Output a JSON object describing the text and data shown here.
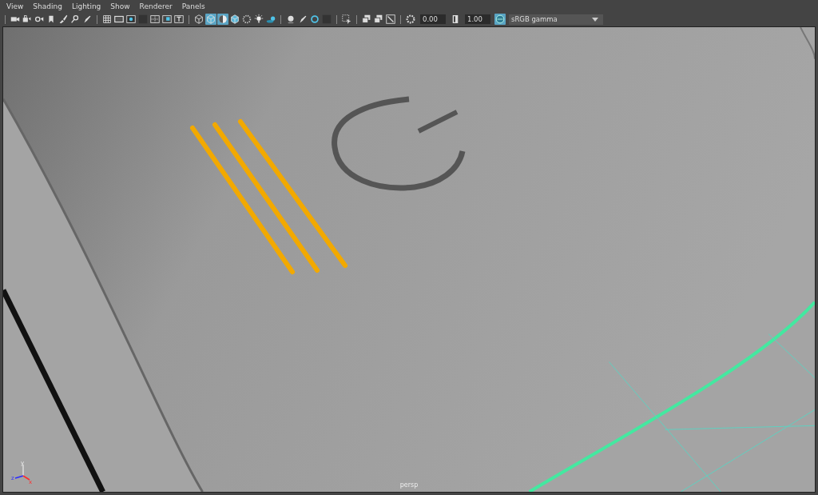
{
  "menus": [
    {
      "label": "View"
    },
    {
      "label": "Shading"
    },
    {
      "label": "Lighting"
    },
    {
      "label": "Show"
    },
    {
      "label": "Renderer"
    },
    {
      "label": "Panels"
    }
  ],
  "toolbar": [
    [
      {
        "kind": "camera",
        "selected": false
      },
      {
        "kind": "camera-lock",
        "selected": false
      },
      {
        "kind": "camera-attr",
        "selected": false
      },
      {
        "kind": "bookmark",
        "selected": false
      },
      {
        "kind": "brush",
        "selected": false
      },
      {
        "kind": "pick",
        "selected": false
      },
      {
        "kind": "pen",
        "selected": false
      }
    ],
    [
      {
        "kind": "grid",
        "selected": false
      },
      {
        "kind": "film",
        "selected": false
      },
      {
        "kind": "dot",
        "selected": false
      },
      {
        "kind": "dark",
        "selected": false
      },
      {
        "kind": "cross",
        "selected": false
      },
      {
        "kind": "square",
        "selected": false
      },
      {
        "kind": "text",
        "selected": false
      }
    ],
    [
      {
        "kind": "wire-cube",
        "selected": false
      },
      {
        "kind": "solid-cube",
        "selected": true
      },
      {
        "kind": "half-sphere",
        "selected": true
      },
      {
        "kind": "solid-cube",
        "selected": false
      },
      {
        "kind": "checker",
        "selected": false
      },
      {
        "kind": "light",
        "selected": false
      },
      {
        "kind": "shadow",
        "selected": false
      }
    ],
    [
      {
        "kind": "sphere",
        "selected": false
      },
      {
        "kind": "pen",
        "selected": false
      },
      {
        "kind": "ring",
        "selected": false
      },
      {
        "kind": "dark",
        "selected": false
      }
    ],
    [
      {
        "kind": "select",
        "selected": false
      }
    ],
    [
      {
        "kind": "stack",
        "selected": false
      },
      {
        "kind": "stack",
        "selected": false
      },
      {
        "kind": "frame",
        "selected": false
      }
    ]
  ],
  "exposure": {
    "value": "0.00"
  },
  "gamma": {
    "value": "1.00"
  },
  "color_space": {
    "value": "sRGB gamma"
  },
  "axis": {
    "x": "x",
    "y": "y",
    "z": "z"
  },
  "camera_label": "persp"
}
